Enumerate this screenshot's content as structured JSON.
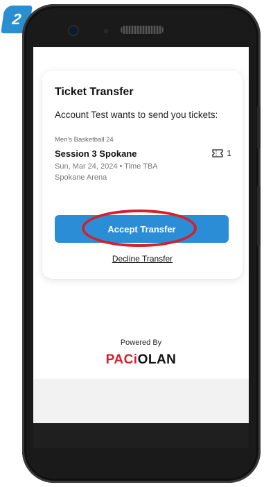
{
  "step": {
    "number": "2"
  },
  "card": {
    "title": "Ticket Transfer",
    "message": "Account Test wants to send you tickets:",
    "event": {
      "category": "Men's Basketball 24",
      "name": "Session 3 Spokane",
      "date": "Sun, Mar 24, 2024 • Time TBA",
      "venue": "Spokane Arena",
      "ticket_count": "1",
      "ticket_icon": "ticket-icon"
    },
    "accept_label": "Accept Transfer",
    "decline_label": "Decline Transfer"
  },
  "footer": {
    "powered_by": "Powered By",
    "brand_part1": "PACi",
    "brand_part2": "OLAN"
  },
  "colors": {
    "accent": "#2b8dd6",
    "highlight_ring": "#d4202b",
    "brand_red": "#d4202b",
    "step_badge": "#2b8fcf"
  }
}
